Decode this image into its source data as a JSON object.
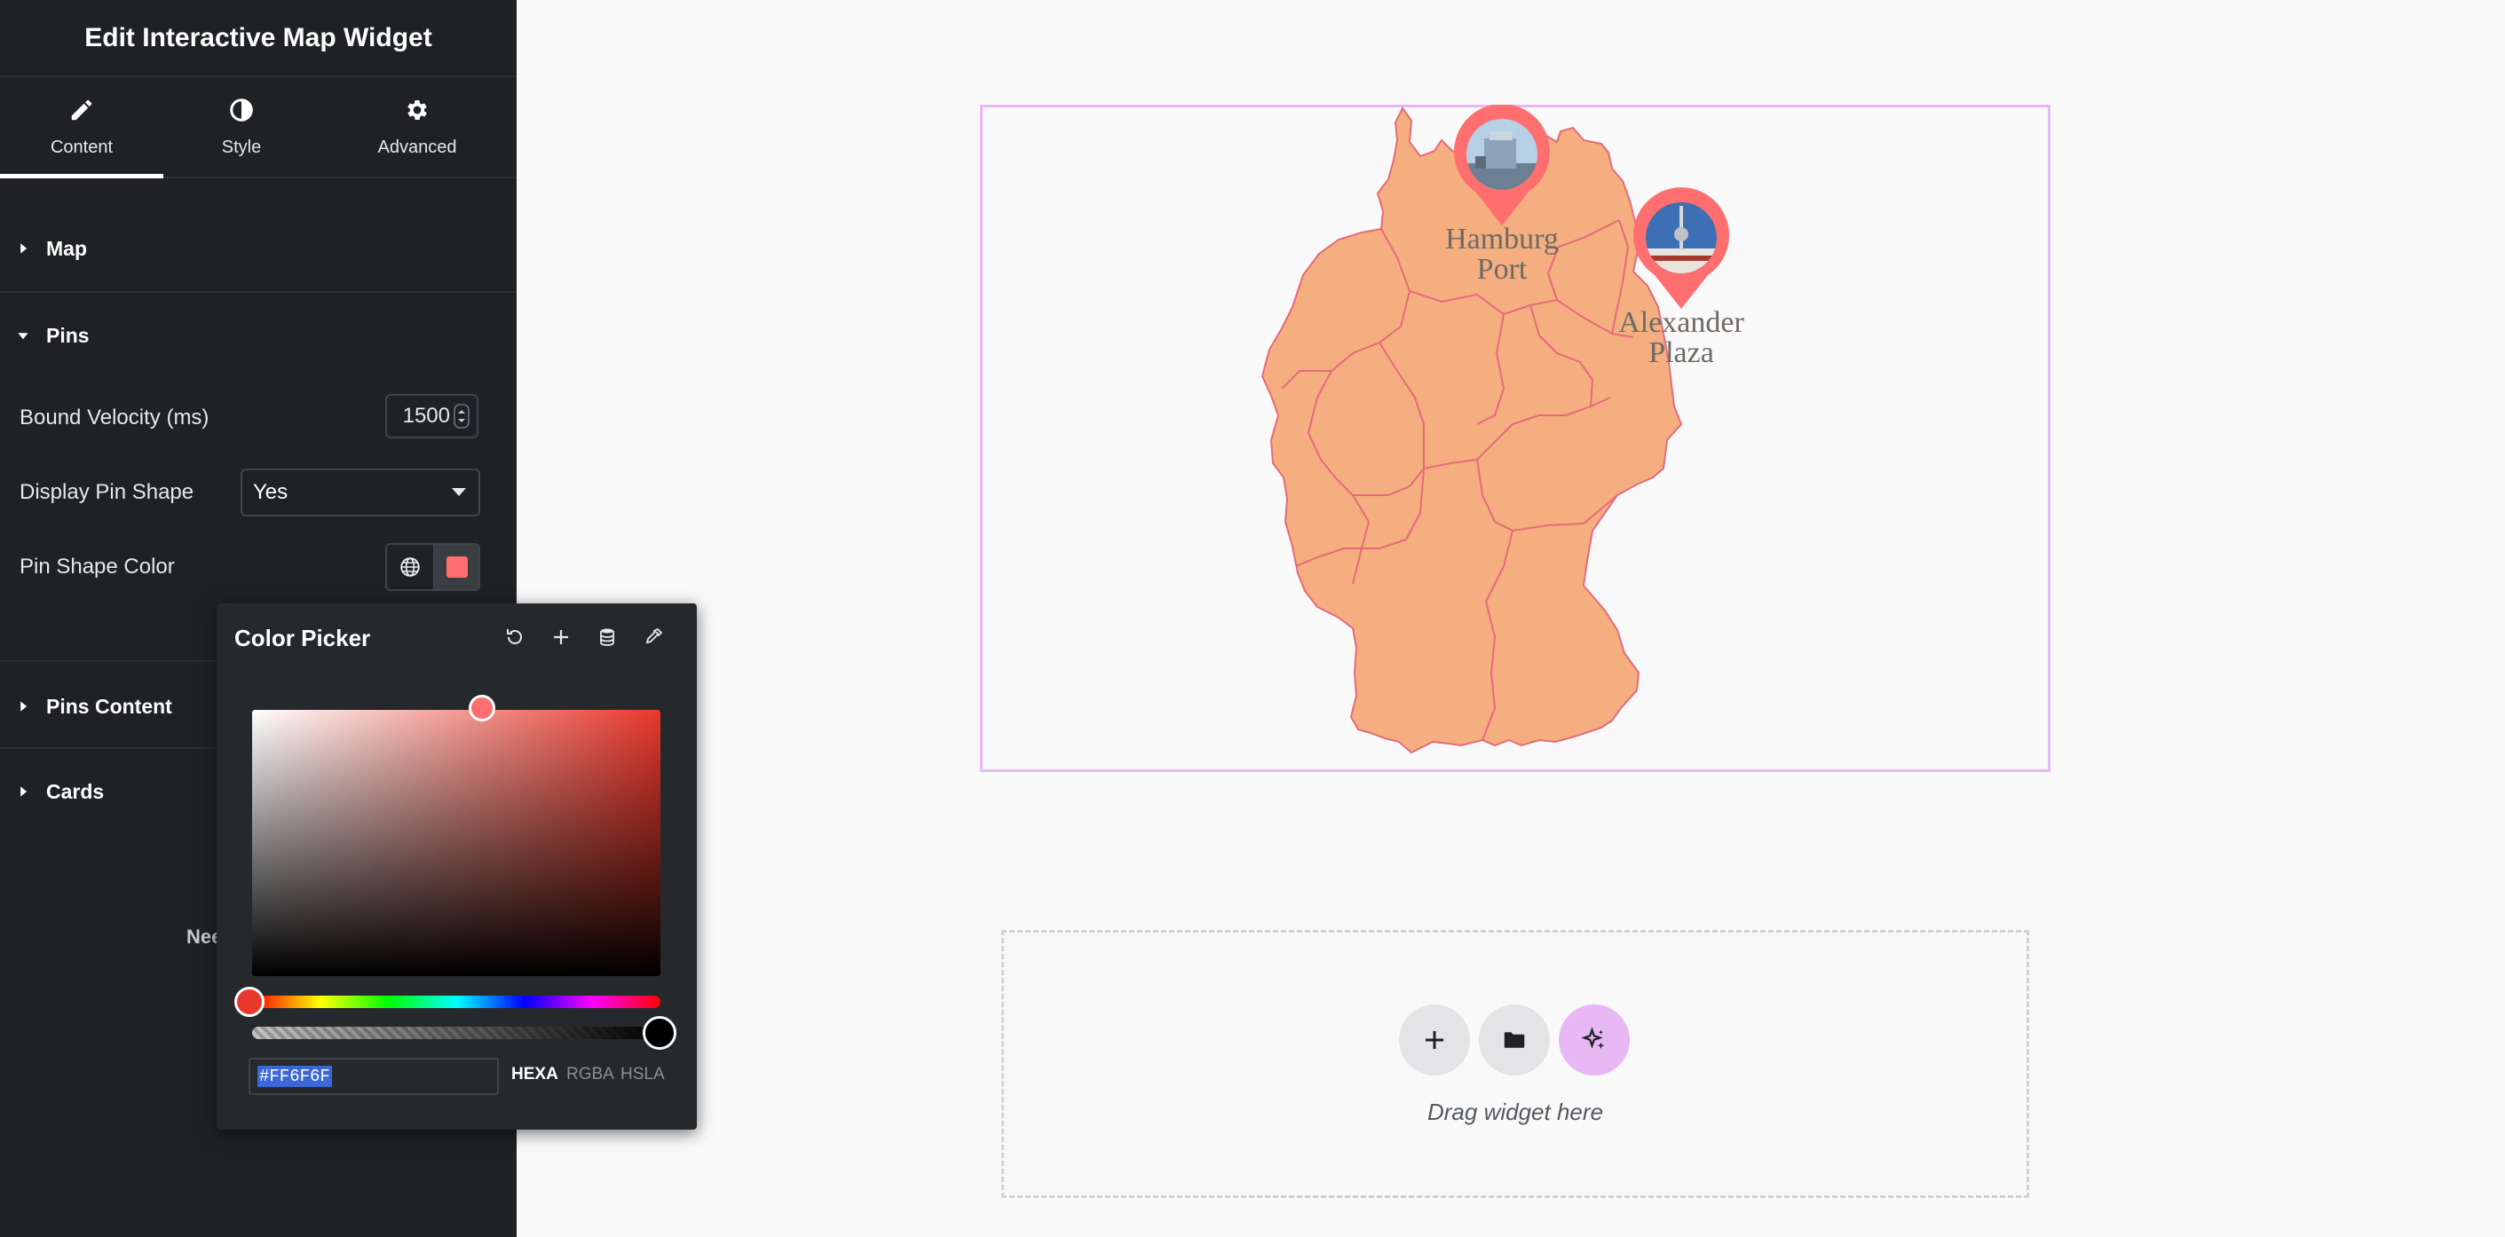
{
  "panel": {
    "title": "Edit Interactive Map Widget",
    "tabs": [
      {
        "label": "Content",
        "icon": "pencil-icon",
        "active": true
      },
      {
        "label": "Style",
        "icon": "half-circle-icon",
        "active": false
      },
      {
        "label": "Advanced",
        "icon": "gear-icon",
        "active": false
      }
    ],
    "sections": {
      "map": "Map",
      "pins": "Pins",
      "pins_content": "Pins Content",
      "cards": "Cards"
    },
    "controls": {
      "bound_velocity_label": "Bound Velocity (ms)",
      "bound_velocity_value": "1500",
      "display_pin_shape_label": "Display Pin Shape",
      "display_pin_shape_value": "Yes",
      "pin_shape_color_label": "Pin Shape Color",
      "pin_shape_color": "#FF6F6F"
    },
    "need_help_partial": "Nee"
  },
  "color_picker": {
    "title": "Color Picker",
    "tools": [
      "reset-icon",
      "add-icon",
      "stack-icon",
      "eyedropper-icon"
    ],
    "hex_value": "#FF6F6F",
    "formats": [
      "HEXA",
      "RGBA",
      "HSLA"
    ],
    "active_format": "HEXA"
  },
  "map": {
    "fill_color": "#f4ae80",
    "border_color": "#e66a7a",
    "pins": [
      {
        "label_line1": "Hamburg",
        "label_line2": "Port"
      },
      {
        "label_line1": "Alexander",
        "label_line2": "Plaza"
      }
    ]
  },
  "dropzone": {
    "text": "Drag widget here",
    "buttons": [
      "add-icon",
      "folder-icon",
      "ai-sparkle-icon"
    ]
  },
  "colors": {
    "sidebar_bg": "#1f2124",
    "accent_purple": "#e8b8f5",
    "pin_color": "#ff6f6f"
  }
}
